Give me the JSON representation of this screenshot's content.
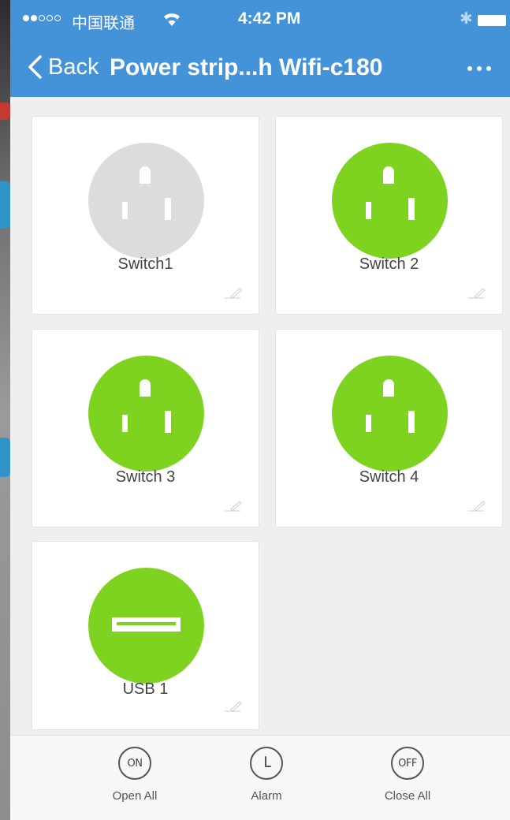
{
  "status_bar": {
    "carrier": "中国联通",
    "time": "4:42 PM"
  },
  "nav": {
    "back_label": "Back",
    "title": "Power strip...h Wifi-c180"
  },
  "colors": {
    "header_blue": "#4493d8",
    "on_green": "#7ed321",
    "off_gray": "#dcdcdc"
  },
  "switches": [
    {
      "label": "Switch1",
      "state": "off",
      "icon": "power-outlet-icon"
    },
    {
      "label": "Switch 2",
      "state": "on",
      "icon": "power-outlet-icon"
    },
    {
      "label": "Switch 3",
      "state": "on",
      "icon": "power-outlet-icon"
    },
    {
      "label": "Switch 4",
      "state": "on",
      "icon": "power-outlet-icon"
    },
    {
      "label": "USB 1",
      "state": "on",
      "icon": "usb-port-icon"
    }
  ],
  "toolbar": {
    "open_all": {
      "icon_text": "ON",
      "label": "Open All"
    },
    "alarm": {
      "icon": "clock-icon",
      "label": "Alarm"
    },
    "close_all": {
      "icon_text": "OFF",
      "label": "Close All"
    }
  }
}
